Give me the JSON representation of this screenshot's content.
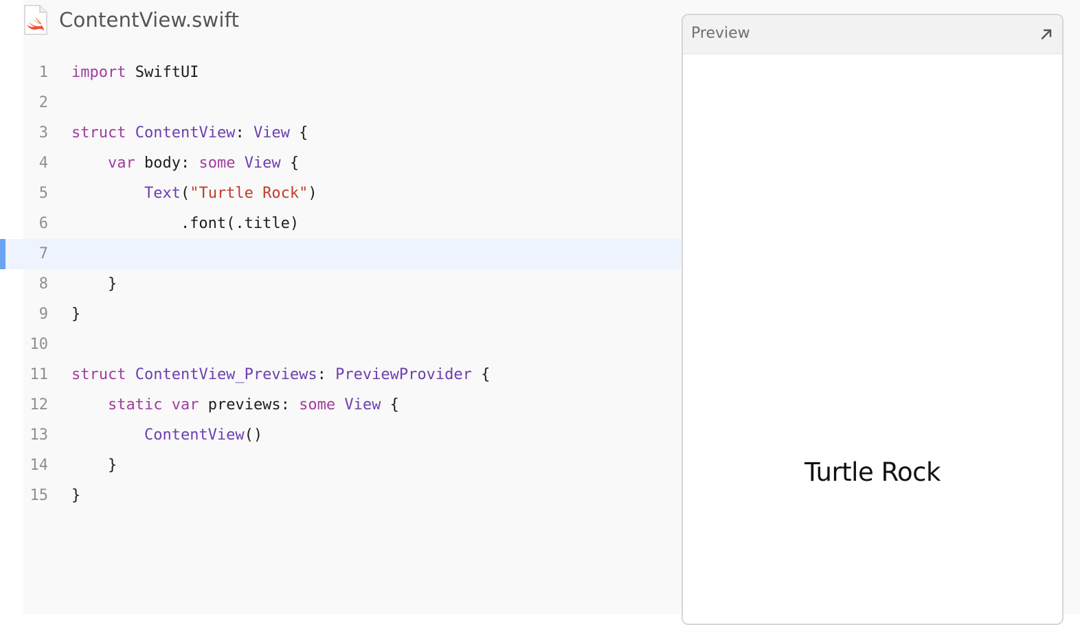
{
  "file": {
    "icon": "swift-file-icon",
    "name": "ContentView.swift"
  },
  "editor": {
    "current_line": 7,
    "lines": [
      {
        "no": "1",
        "tokens": [
          {
            "t": "import",
            "c": "kw"
          },
          {
            "t": " SwiftUI",
            "c": "pl"
          }
        ]
      },
      {
        "no": "2",
        "tokens": []
      },
      {
        "no": "3",
        "tokens": [
          {
            "t": "struct",
            "c": "kw"
          },
          {
            "t": " ",
            "c": "pl"
          },
          {
            "t": "ContentView",
            "c": "ty"
          },
          {
            "t": ": ",
            "c": "pl"
          },
          {
            "t": "View",
            "c": "ty"
          },
          {
            "t": " {",
            "c": "pl"
          }
        ]
      },
      {
        "no": "4",
        "tokens": [
          {
            "t": "    ",
            "c": "pl"
          },
          {
            "t": "var",
            "c": "kw"
          },
          {
            "t": " body: ",
            "c": "pl"
          },
          {
            "t": "some",
            "c": "kw"
          },
          {
            "t": " ",
            "c": "pl"
          },
          {
            "t": "View",
            "c": "ty"
          },
          {
            "t": " {",
            "c": "pl"
          }
        ]
      },
      {
        "no": "5",
        "tokens": [
          {
            "t": "        ",
            "c": "pl"
          },
          {
            "t": "Text",
            "c": "ty"
          },
          {
            "t": "(",
            "c": "pl"
          },
          {
            "t": "\"Turtle Rock\"",
            "c": "st"
          },
          {
            "t": ")",
            "c": "pl"
          }
        ]
      },
      {
        "no": "6",
        "tokens": [
          {
            "t": "            .font(.title)",
            "c": "pl"
          }
        ]
      },
      {
        "no": "7",
        "tokens": []
      },
      {
        "no": "8",
        "tokens": [
          {
            "t": "    }",
            "c": "pl"
          }
        ]
      },
      {
        "no": "9",
        "tokens": [
          {
            "t": "}",
            "c": "pl"
          }
        ]
      },
      {
        "no": "10",
        "tokens": []
      },
      {
        "no": "11",
        "tokens": [
          {
            "t": "struct",
            "c": "kw"
          },
          {
            "t": " ",
            "c": "pl"
          },
          {
            "t": "ContentView_Previews",
            "c": "ty"
          },
          {
            "t": ": ",
            "c": "pl"
          },
          {
            "t": "PreviewProvider",
            "c": "ty"
          },
          {
            "t": " {",
            "c": "pl"
          }
        ]
      },
      {
        "no": "12",
        "tokens": [
          {
            "t": "    ",
            "c": "pl"
          },
          {
            "t": "static",
            "c": "kw"
          },
          {
            "t": " ",
            "c": "pl"
          },
          {
            "t": "var",
            "c": "kw"
          },
          {
            "t": " previews: ",
            "c": "pl"
          },
          {
            "t": "some",
            "c": "kw"
          },
          {
            "t": " ",
            "c": "pl"
          },
          {
            "t": "View",
            "c": "ty"
          },
          {
            "t": " {",
            "c": "pl"
          }
        ]
      },
      {
        "no": "13",
        "tokens": [
          {
            "t": "        ",
            "c": "pl"
          },
          {
            "t": "ContentView",
            "c": "ty"
          },
          {
            "t": "()",
            "c": "pl"
          }
        ]
      },
      {
        "no": "14",
        "tokens": [
          {
            "t": "    }",
            "c": "pl"
          }
        ]
      },
      {
        "no": "15",
        "tokens": [
          {
            "t": "}",
            "c": "pl"
          }
        ]
      }
    ]
  },
  "preview": {
    "title": "Preview",
    "expand_icon": "expand-arrow-icon",
    "rendered_text": "Turtle Rock"
  },
  "colors": {
    "keyword": "#a03c9d",
    "type": "#6b3fb0",
    "string": "#c43b2a",
    "current_line_bg": "#eef4fd",
    "current_line_marker": "#6aa3f0"
  }
}
